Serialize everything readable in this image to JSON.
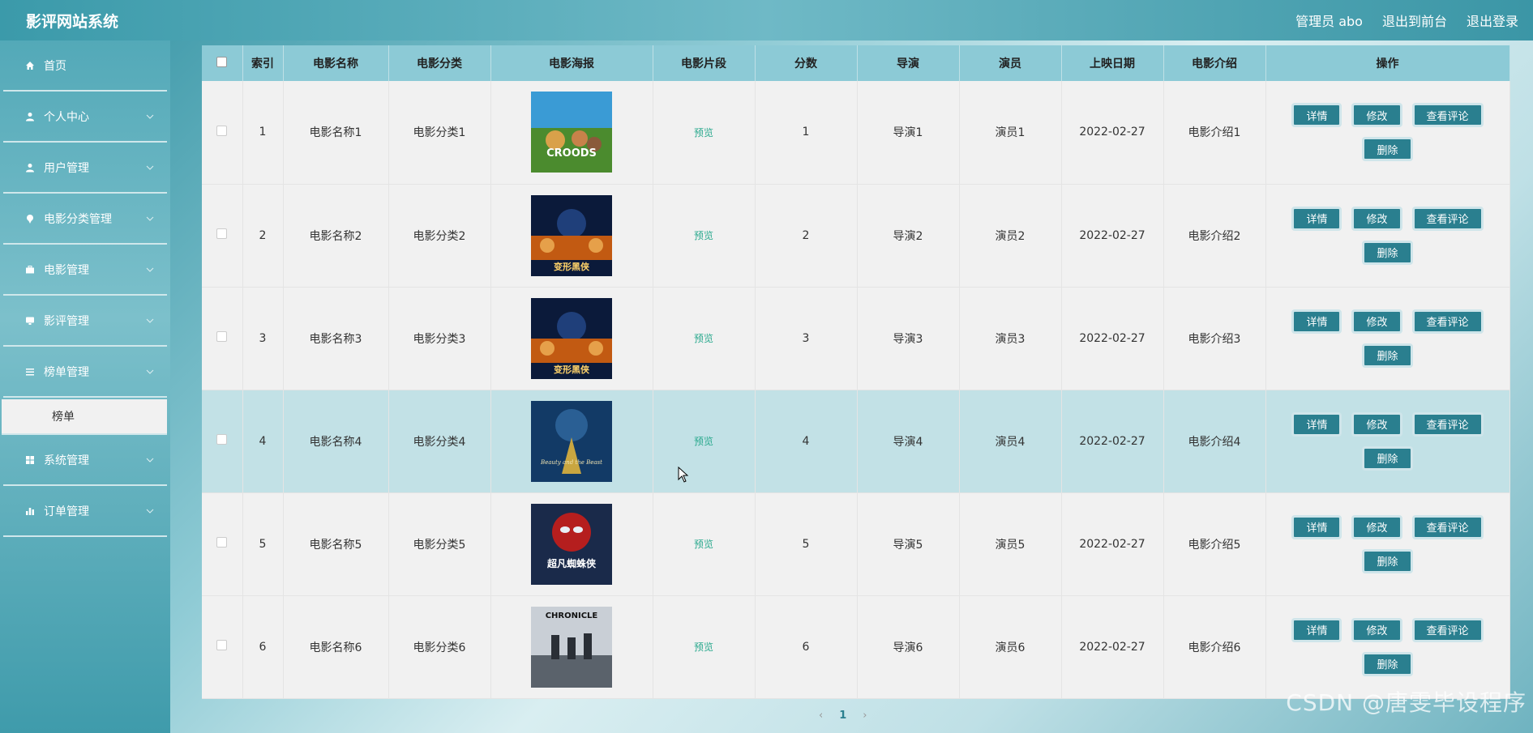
{
  "app": {
    "title": "影评网站系统",
    "topnav": [
      "管理员 abo",
      "退出到前台",
      "退出登录"
    ]
  },
  "sidebar": {
    "items": [
      {
        "label": "首页",
        "icon": "home-icon"
      },
      {
        "label": "个人中心",
        "icon": "user-icon"
      },
      {
        "label": "用户管理",
        "icon": "user-icon"
      },
      {
        "label": "电影分类管理",
        "icon": "pin-icon"
      },
      {
        "label": "电影管理",
        "icon": "briefcase-icon"
      },
      {
        "label": "影评管理",
        "icon": "screen-icon"
      },
      {
        "label": "榜单管理",
        "icon": "list-icon"
      },
      {
        "label": "系统管理",
        "icon": "grid-icon"
      },
      {
        "label": "订单管理",
        "icon": "bar-chart-icon"
      }
    ],
    "sub_item": "榜单"
  },
  "table": {
    "headers": [
      "索引",
      "电影名称",
      "电影分类",
      "电影海报",
      "电影片段",
      "分数",
      "导演",
      "演员",
      "上映日期",
      "电影介绍",
      "操作"
    ],
    "preview_label": "预览",
    "buttons": {
      "detail": "详情",
      "edit": "修改",
      "comments": "查看评论",
      "delete": "删除"
    },
    "rows": [
      {
        "index": "1",
        "name": "电影名称1",
        "category": "电影分类1",
        "score": "1",
        "director": "导演1",
        "actor": "演员1",
        "date": "2022-02-27",
        "intro": "电影介绍1",
        "poster_text": "CROODS"
      },
      {
        "index": "2",
        "name": "电影名称2",
        "category": "电影分类2",
        "score": "2",
        "director": "导演2",
        "actor": "演员2",
        "date": "2022-02-27",
        "intro": "电影介绍2",
        "poster_text": "变形黑侠"
      },
      {
        "index": "3",
        "name": "电影名称3",
        "category": "电影分类3",
        "score": "3",
        "director": "导演3",
        "actor": "演员3",
        "date": "2022-02-27",
        "intro": "电影介绍3",
        "poster_text": "变形黑侠"
      },
      {
        "index": "4",
        "name": "电影名称4",
        "category": "电影分类4",
        "score": "4",
        "director": "导演4",
        "actor": "演员4",
        "date": "2022-02-27",
        "intro": "电影介绍4",
        "poster_text": "Beauty and the Beast"
      },
      {
        "index": "5",
        "name": "电影名称5",
        "category": "电影分类5",
        "score": "5",
        "director": "导演5",
        "actor": "演员5",
        "date": "2022-02-27",
        "intro": "电影介绍5",
        "poster_text": "超凡蜘蛛侠"
      },
      {
        "index": "6",
        "name": "电影名称6",
        "category": "电影分类6",
        "score": "6",
        "director": "导演6",
        "actor": "演员6",
        "date": "2022-02-27",
        "intro": "电影介绍6",
        "poster_text": "CHRONICLE"
      }
    ]
  },
  "pager": {
    "prev": "‹",
    "current": "1",
    "next": "›"
  },
  "watermark": "CSDN @唐雯毕设程序",
  "colors": {
    "accent": "#2a7f8f",
    "header": "#8ccad6",
    "highlight_row": "#c2e1e6"
  }
}
